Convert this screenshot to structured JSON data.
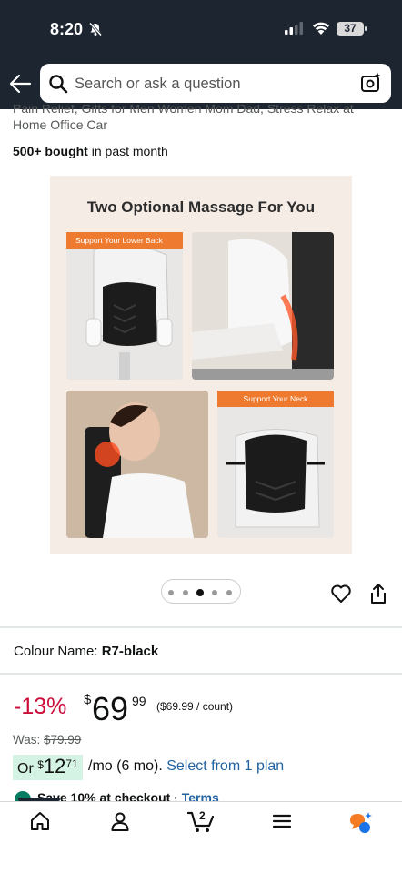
{
  "status_bar": {
    "time": "8:20",
    "battery": "37"
  },
  "search": {
    "placeholder": "Search or ask a question"
  },
  "product": {
    "title_fragment_line1": "Pain Relief, Gifts for Men Women Mom Dad, Stress Relax at",
    "title_fragment_line2": "Home Office Car",
    "bought_count": "500+ bought",
    "bought_suffix": " in past month"
  },
  "image": {
    "title": "Two Optional Massage For You",
    "tag_lower": "Support Your Lower Back",
    "tag_neck": "Support Your Neck",
    "carousel_count": 5,
    "carousel_active": 2
  },
  "colour": {
    "label": "Colour Name: ",
    "value": "R7-black"
  },
  "price": {
    "discount": "-13%",
    "symbol": "$",
    "whole": "69",
    "fraction": "99",
    "unit_price": "($69.99 / count)",
    "was_label": "Was: ",
    "was_value": "$79.99"
  },
  "monthly": {
    "prefix": "Or ",
    "symbol": "$",
    "whole": "12",
    "fraction": "71",
    "suffix": "/mo (6 mo). ",
    "plan_link": "Select from 1 plan"
  },
  "save": {
    "text": "Save 10% at checkout",
    "terms": "Terms"
  },
  "nav": {
    "cart_count": "2"
  },
  "colors": {
    "header_bg": "#1d2530",
    "discount": "#cc0c39",
    "link": "#2162a1",
    "monthly_bg": "#d5f3e4",
    "tag": "#ee7a2f"
  }
}
